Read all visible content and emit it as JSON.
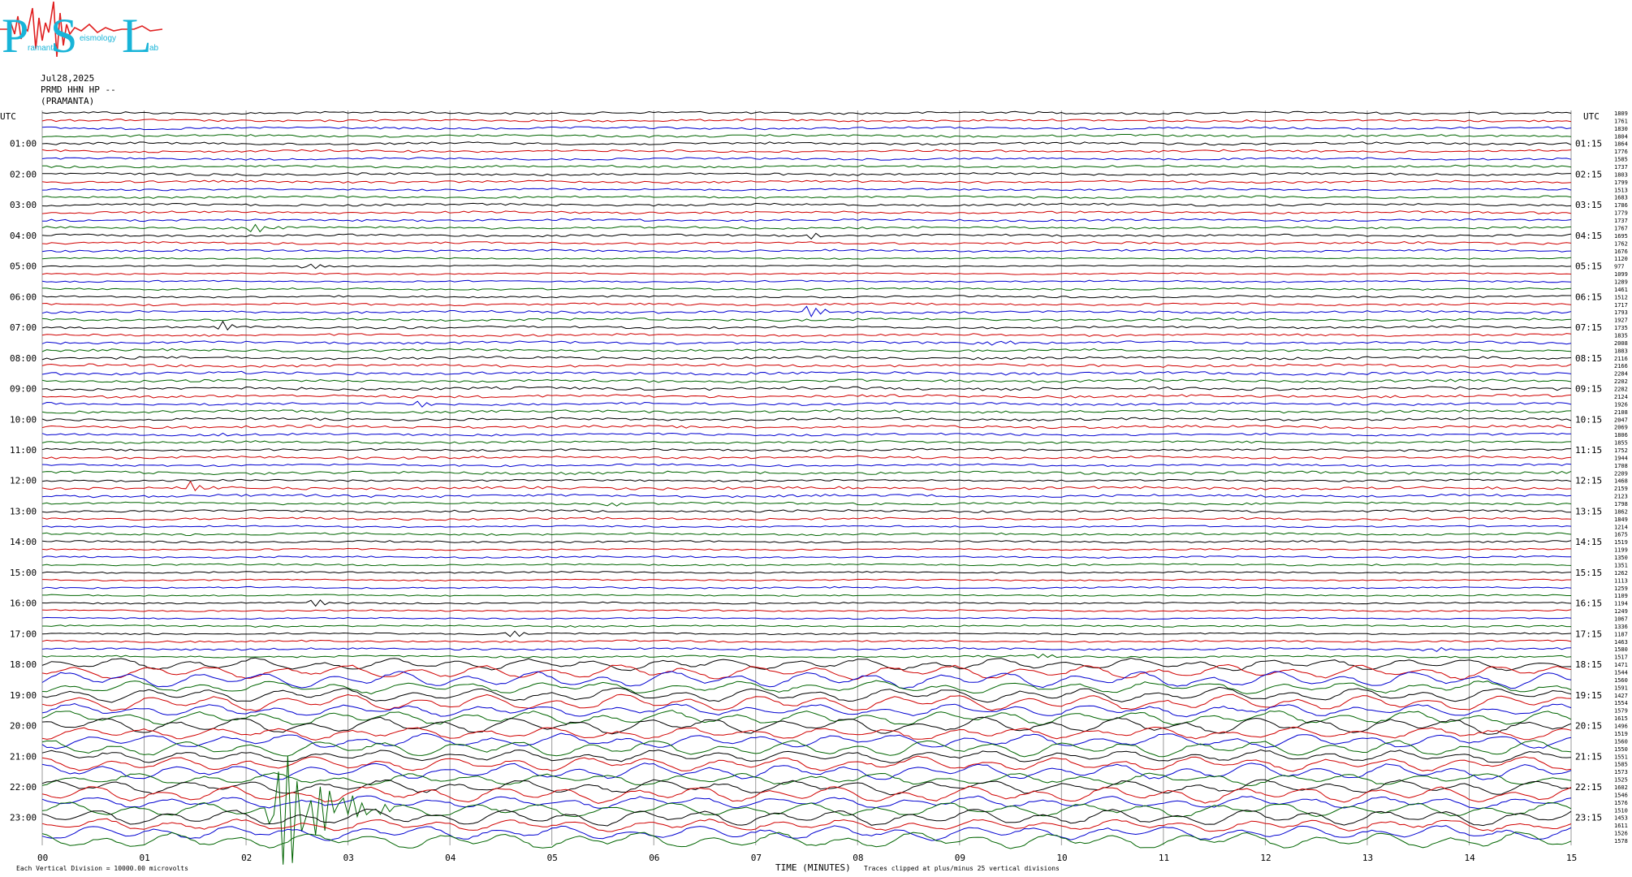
{
  "logo": {
    "letters": [
      "P",
      "S",
      "L"
    ],
    "words": [
      "ramanta",
      "eismology",
      "ab"
    ]
  },
  "header": {
    "date": "Jul28,2025",
    "station": "PRMD HHN HP --",
    "name": "(PRAMANTA)"
  },
  "chart_data": {
    "type": "line",
    "title": "",
    "xlabel": "TIME (MINUTES)",
    "ylabel": "UTC",
    "xlim": [
      0,
      15
    ],
    "x_ticks": [
      "00",
      "01",
      "02",
      "03",
      "04",
      "05",
      "06",
      "07",
      "08",
      "09",
      "10",
      "11",
      "12",
      "13",
      "14",
      "15"
    ],
    "left_hour_labels": [
      "01:00",
      "02:00",
      "03:00",
      "04:00",
      "05:00",
      "06:00",
      "07:00",
      "08:00",
      "09:00",
      "10:00",
      "11:00",
      "12:00",
      "13:00",
      "14:00",
      "15:00",
      "16:00",
      "17:00",
      "18:00",
      "19:00",
      "20:00",
      "21:00",
      "22:00",
      "23:00"
    ],
    "right_hour_labels": [
      "01:15",
      "02:15",
      "03:15",
      "04:15",
      "05:15",
      "06:15",
      "07:15",
      "08:15",
      "09:15",
      "10:15",
      "11:15",
      "12:15",
      "13:15",
      "14:15",
      "15:15",
      "16:15",
      "17:15",
      "18:15",
      "19:15",
      "20:15",
      "21:15",
      "22:15",
      "23:15"
    ],
    "left_axis_title": "UTC",
    "right_axis_title": "UTC",
    "trace_rms_counts": [
      1809,
      1761,
      1830,
      1804,
      1864,
      1776,
      1585,
      1737,
      1803,
      1799,
      1513,
      1683,
      1786,
      1779,
      1737,
      1767,
      1695,
      1762,
      1676,
      1120,
      977,
      1099,
      1289,
      1461,
      1512,
      1717,
      1793,
      1927,
      1735,
      1835,
      2008,
      1883,
      2116,
      2166,
      2284,
      2202,
      2282,
      2124,
      1926,
      2108,
      2047,
      2069,
      1806,
      1855,
      1752,
      1944,
      1708,
      2209,
      1468,
      2159,
      2123,
      1798,
      1862,
      1849,
      1214,
      1675,
      1519,
      1199,
      1350,
      1351,
      1262,
      1113,
      1259,
      1109,
      1194,
      1249,
      1067,
      1336,
      1187,
      1463,
      1580,
      1517,
      1471,
      1544,
      1560,
      1591,
      1427,
      1554,
      1579,
      1615,
      1496,
      1519,
      1560,
      1550,
      1551,
      1585,
      1573,
      1525,
      1602,
      1546,
      1576,
      1510,
      1453,
      1611,
      1526,
      1578
    ],
    "trace_colors": [
      "#000000",
      "#d00000",
      "#0000d0",
      "#006400"
    ],
    "traces_per_hour": 4,
    "events": [
      {
        "trace": 15,
        "minute": 2.05,
        "amplitude": 1.2
      },
      {
        "trace": 16,
        "minute": 7.45,
        "amplitude": 1.0
      },
      {
        "trace": 20,
        "minute": 2.55,
        "amplitude": 1.3
      },
      {
        "trace": 26,
        "minute": 7.5,
        "amplitude": 1.6
      },
      {
        "trace": 28,
        "minute": 1.75,
        "amplitude": 1.2
      },
      {
        "trace": 30,
        "minute": 9.3,
        "amplitude": 1.1
      },
      {
        "trace": 38,
        "minute": 3.7,
        "amplitude": 0.9
      },
      {
        "trace": 42,
        "minute": 1.6,
        "amplitude": 1.0
      },
      {
        "trace": 49,
        "minute": 1.45,
        "amplitude": 1.1
      },
      {
        "trace": 51,
        "minute": 5.5,
        "amplitude": 0.9
      },
      {
        "trace": 64,
        "minute": 2.6,
        "amplitude": 1.4
      },
      {
        "trace": 68,
        "minute": 4.55,
        "amplitude": 1.2
      },
      {
        "trace": 71,
        "minute": 9.7,
        "amplitude": 1.0
      },
      {
        "trace": 70,
        "minute": 13.55,
        "amplitude": 1.0
      },
      {
        "trace": 91,
        "minute": 2.25,
        "amplitude": 18.0
      }
    ],
    "footer_left": "Each Vertical Division = 10000.00 microvolts",
    "footer_right": "Traces clipped at plus/minus 25 vertical divisions"
  }
}
